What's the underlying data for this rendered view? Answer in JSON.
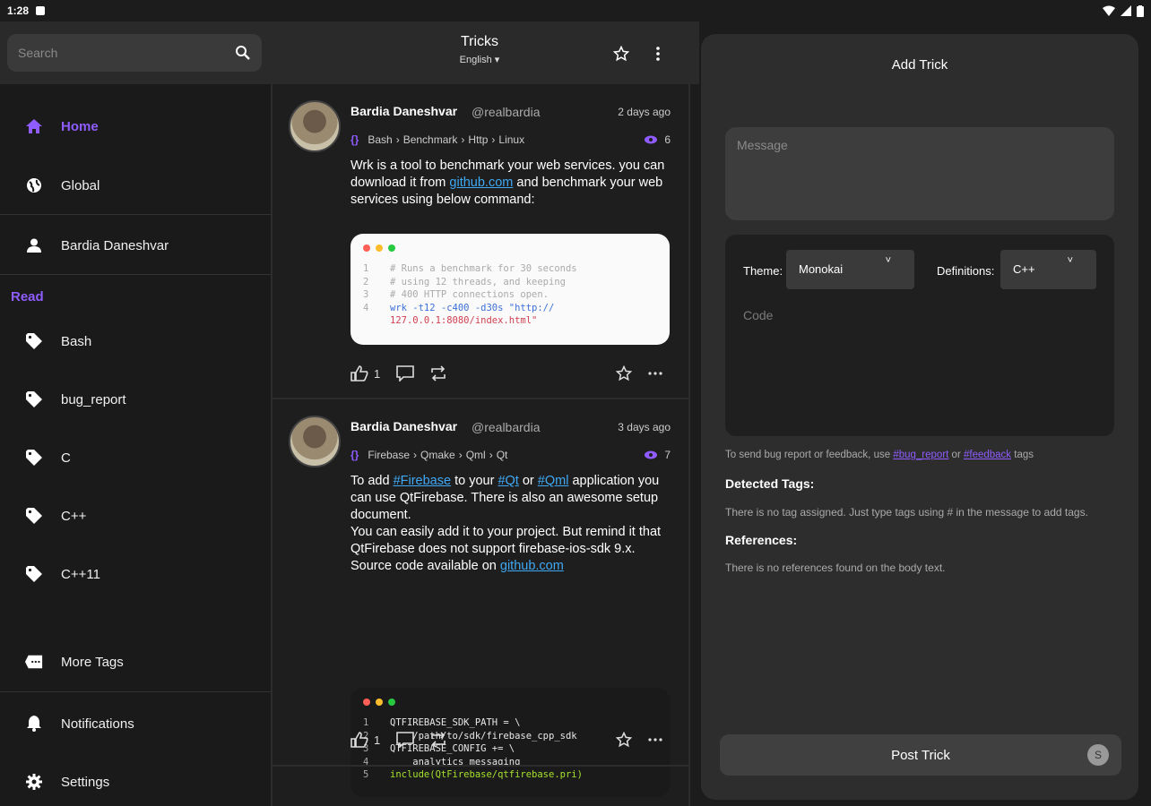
{
  "status": {
    "time": "1:28"
  },
  "search": {
    "placeholder": "Search"
  },
  "header": {
    "title": "Tricks",
    "language": "English"
  },
  "sidebar": {
    "items": [
      {
        "label": "Home"
      },
      {
        "label": "Global"
      },
      {
        "label": "Bardia Daneshvar"
      }
    ],
    "section_label": "Read",
    "tags": [
      {
        "label": "Bash"
      },
      {
        "label": "bug_report"
      },
      {
        "label": "C"
      },
      {
        "label": "C++"
      },
      {
        "label": "C++11"
      }
    ],
    "more_tags": "More Tags",
    "notifications": "Notifications",
    "settings": "Settings"
  },
  "posts": [
    {
      "author": "Bardia Daneshvar",
      "handle": "@realbardia",
      "time": "2 days ago",
      "tags": [
        "Bash",
        "Benchmark",
        "Http",
        "Linux"
      ],
      "views": "6",
      "body_before": "Wrk is a tool to benchmark your web services. you can download it from ",
      "link": "github.com",
      "body_after": " and benchmark your web services using below command:",
      "code": [
        {
          "n": "1",
          "t": "# Runs a benchmark for 30 seconds"
        },
        {
          "n": "2",
          "t": "# using 12 threads, and keeping"
        },
        {
          "n": "3",
          "t": "# 400 HTTP connections open."
        },
        {
          "n": "4",
          "t": "wrk -t12 -c400 -d30s \"http://"
        },
        {
          "n": "",
          "t": "127.0.0.1:8080/index.html\""
        }
      ],
      "likes": "1"
    },
    {
      "author": "Bardia Daneshvar",
      "handle": "@realbardia",
      "time": "3 days ago",
      "tags": [
        "Firebase",
        "Qmake",
        "Qml",
        "Qt"
      ],
      "views": "7",
      "b1": "To add ",
      "l1": "#Firebase",
      "b2": " to your ",
      "l2": "#Qt",
      "b3": " or ",
      "l3": "#Qml",
      "b4": " application you can use QtFirebase. There is also an awesome setup document.",
      "b5": "You can easily add it to your project. But remind it that QtFirebase does not support firebase-ios-sdk 9.x.",
      "b6": "Source code available on ",
      "l4": "github.com",
      "code": [
        {
          "n": "1",
          "t": "QTFIREBASE_SDK_PATH = \\"
        },
        {
          "n": "2",
          "t": "    /path/to/sdk/firebase_cpp_sdk"
        },
        {
          "n": "3",
          "t": "QTFIREBASE_CONFIG += \\"
        },
        {
          "n": "4",
          "t": "    analytics messaging"
        },
        {
          "n": "5",
          "t": "include(QtFirebase/qtfirebase.pri)"
        }
      ],
      "likes": "1"
    }
  ],
  "panel": {
    "title": "Add Trick",
    "message_placeholder": "Message",
    "theme_label": "Theme:",
    "theme_value": "Monokai",
    "definitions_label": "Definitions:",
    "definitions_value": "C++",
    "code_placeholder": "Code",
    "hint_before": "To send bug report or feedback, use ",
    "hint_tag1": "#bug_report",
    "hint_or": " or ",
    "hint_tag2": "#feedback",
    "hint_after": " tags",
    "detected_title": "Detected Tags:",
    "detected_text": "There is no tag assigned. Just type tags using # in the message to add tags.",
    "references_title": "References:",
    "references_text": "There is no references found on the body text.",
    "post_button": "Post Trick",
    "post_counter": "S"
  },
  "colors": {
    "accent": "#8f5cff",
    "link": "#3fa9f5"
  }
}
